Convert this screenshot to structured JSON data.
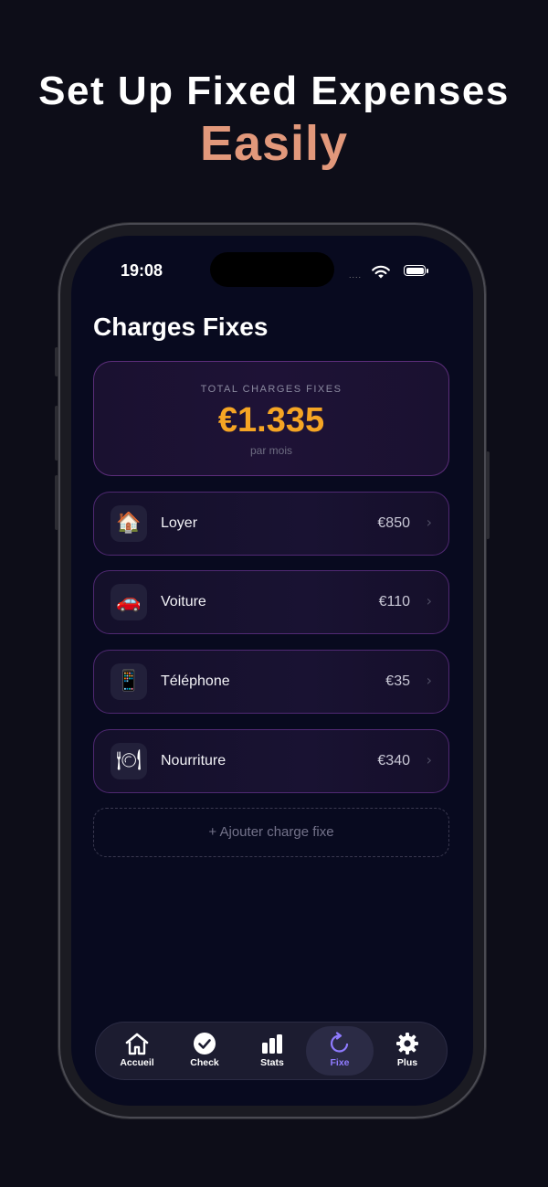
{
  "headline": {
    "line1": "Set Up Fixed Expenses",
    "line2": "Easily"
  },
  "status_bar": {
    "time": "19:08",
    "signal": "....",
    "wifi_icon": "wifi-icon",
    "battery_icon": "battery-icon"
  },
  "screen": {
    "title": "Charges Fixes",
    "summary": {
      "label": "TOTAL CHARGES FIXES",
      "amount": "€1.335",
      "period": "par mois"
    },
    "items": [
      {
        "icon": "house-icon",
        "glyph": "🏠",
        "label": "Loyer",
        "amount": "€850",
        "chevron": "›"
      },
      {
        "icon": "car-icon",
        "glyph": "🚗",
        "label": "Voiture",
        "amount": "€110",
        "chevron": "›"
      },
      {
        "icon": "phone-icon",
        "glyph": "📱",
        "label": "Téléphone",
        "amount": "€35",
        "chevron": "›"
      },
      {
        "icon": "plate-icon",
        "glyph": "🍽",
        "label": "Nourriture",
        "amount": "€340",
        "chevron": "›"
      }
    ],
    "add_button": "+ Ajouter charge fixe"
  },
  "tabbar": {
    "tabs": [
      {
        "label": "Accueil",
        "icon": "home-icon",
        "active": false
      },
      {
        "label": "Check",
        "icon": "check-icon",
        "active": false
      },
      {
        "label": "Stats",
        "icon": "bar-chart-icon",
        "active": false
      },
      {
        "label": "Fixe",
        "icon": "repeat-icon",
        "active": true
      },
      {
        "label": "Plus",
        "icon": "gear-icon",
        "active": false
      }
    ]
  },
  "colors": {
    "background": "#0d0d18",
    "headline_accent": "#e2987b",
    "amount_accent": "#f5a524",
    "active_tab": "#8f7bff",
    "card_border": "#a050d2"
  }
}
